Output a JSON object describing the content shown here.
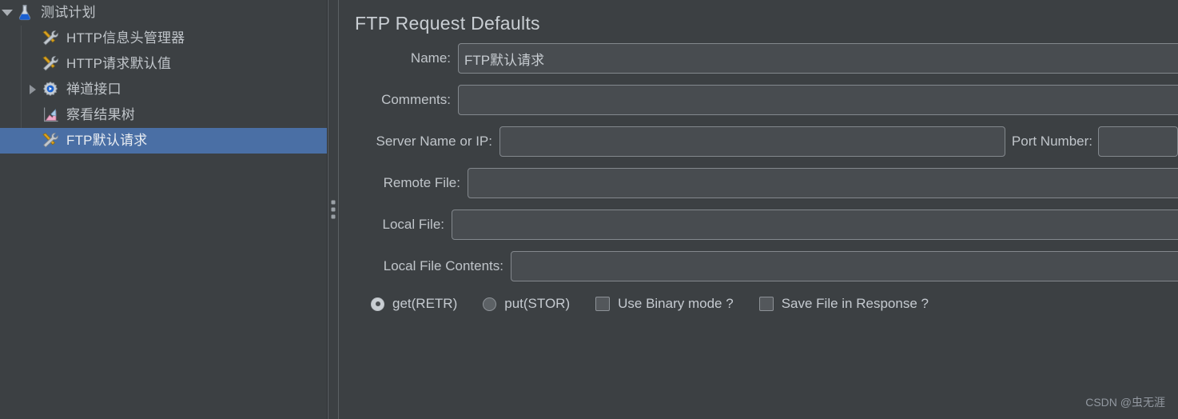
{
  "sidebar": {
    "items": [
      {
        "label": "测试计划",
        "icon": "flask-icon",
        "depth": 0,
        "twisty": "down",
        "selected": false
      },
      {
        "label": "HTTP信息头管理器",
        "icon": "tools-icon",
        "depth": 1,
        "twisty": "none",
        "selected": false
      },
      {
        "label": "HTTP请求默认值",
        "icon": "tools-icon",
        "depth": 1,
        "twisty": "none",
        "selected": false
      },
      {
        "label": "禅道接口",
        "icon": "gear-icon",
        "depth": 1,
        "twisty": "right",
        "selected": false
      },
      {
        "label": "察看结果树",
        "icon": "results-tree-icon",
        "depth": 1,
        "twisty": "none",
        "selected": false
      },
      {
        "label": "FTP默认请求",
        "icon": "tools-icon",
        "depth": 1,
        "twisty": "none",
        "selected": true
      }
    ]
  },
  "main": {
    "title": "FTP Request Defaults",
    "fields": {
      "name_label": "Name:",
      "name_value": "FTP默认请求",
      "comments_label": "Comments:",
      "comments_value": "",
      "server_label": "Server Name or IP:",
      "server_value": "",
      "port_label": "Port Number:",
      "port_value": "",
      "remote_file_label": "Remote File:",
      "remote_file_value": "",
      "local_file_label": "Local File:",
      "local_file_value": "",
      "local_file_contents_label": "Local File Contents:",
      "local_file_contents_value": ""
    },
    "options": {
      "get_label": "get(RETR)",
      "get_selected": true,
      "put_label": "put(STOR)",
      "put_selected": false,
      "binary_label": "Use Binary mode ?",
      "binary_checked": false,
      "save_label": "Save File in Response ?",
      "save_checked": false
    }
  },
  "watermark": "CSDN @虫无涯",
  "colors": {
    "background": "#3c4043",
    "field": "#484c50",
    "selection": "#4a6fa5",
    "text": "#c0c5ca"
  }
}
